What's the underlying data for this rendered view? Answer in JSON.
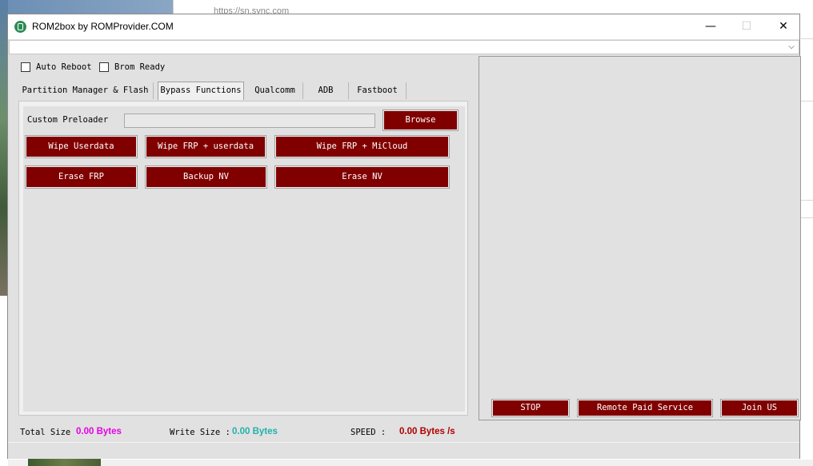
{
  "background": {
    "browser_url": "https://sn.sync.com"
  },
  "window": {
    "title": "ROM2box by ROMProvider.COM",
    "controls": {
      "minimize": "—",
      "maximize": "☐",
      "close": "✕"
    },
    "combo_arrow": "⌵"
  },
  "options": {
    "auto_reboot": {
      "label": "Auto Reboot",
      "checked": false
    },
    "brom_ready": {
      "label": "Brom Ready",
      "checked": false
    }
  },
  "tabs": [
    {
      "label": "Partition Manager & Flash",
      "active": false
    },
    {
      "label": "Bypass Functions",
      "active": true
    },
    {
      "label": "Qualcomm",
      "active": false
    },
    {
      "label": "ADB",
      "active": false
    },
    {
      "label": "Fastboot",
      "active": false
    }
  ],
  "bypass": {
    "custom_preloader_label": "Custom Preloader",
    "custom_preloader_value": "",
    "browse": "Browse",
    "wipe_userdata": "Wipe Userdata",
    "wipe_frp_userdata": "Wipe FRP + userdata",
    "wipe_frp_micloud": "Wipe FRP +  MiCloud",
    "erase_frp": "Erase FRP",
    "backup_nv": "Backup NV",
    "erase_nv": "Erase NV"
  },
  "log_panel": {
    "stop": "STOP",
    "remote_paid_service": "Remote Paid Service",
    "join_us": "Join US"
  },
  "status": {
    "total_size_label": "Total Size",
    "total_size_value": "0.00 Bytes",
    "write_size_label": "Write Size :",
    "write_size_value": "0.00 Bytes",
    "speed_label": "SPEED :",
    "speed_value": "0.00 Bytes /s"
  },
  "colors": {
    "button_bg": "#800000",
    "total_size": "#e600e6",
    "write_size": "#20b2aa",
    "speed": "#b00000"
  }
}
